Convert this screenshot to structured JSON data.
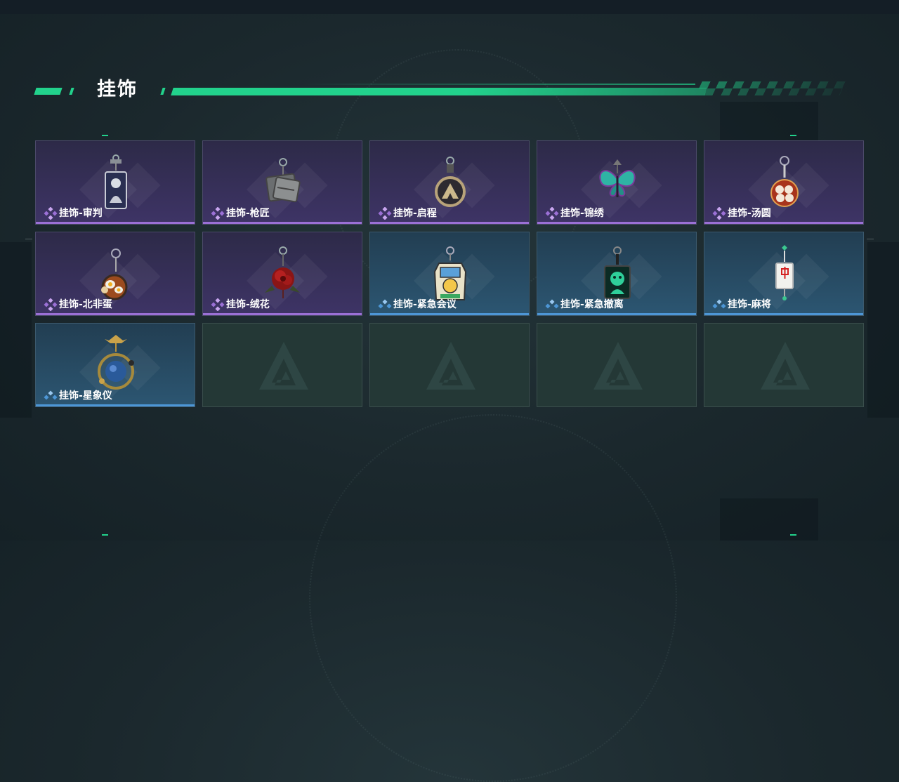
{
  "page": {
    "title": "挂饰"
  },
  "colors": {
    "accent_green": "#22d28c",
    "rarity_purple": "#9b70d6",
    "rarity_blue": "#4d96d6",
    "card_purple": "#3e3466",
    "card_blue": "#2c5672",
    "card_empty": "#243836"
  },
  "items": [
    {
      "label": "挂饰-审判",
      "rarity": "purple",
      "icon": "judgment-card-charm-icon"
    },
    {
      "label": "挂饰-枪匠",
      "rarity": "purple",
      "icon": "gunsmith-tag-charm-icon"
    },
    {
      "label": "挂饰-启程",
      "rarity": "purple",
      "icon": "departure-ring-charm-icon"
    },
    {
      "label": "挂饰-锦绣",
      "rarity": "purple",
      "icon": "butterfly-charm-icon"
    },
    {
      "label": "挂饰-汤圆",
      "rarity": "purple",
      "icon": "tangyuan-bowl-charm-icon"
    },
    {
      "label": "挂饰-北非蛋",
      "rarity": "purple",
      "icon": "shakshuka-charm-icon"
    },
    {
      "label": "挂饰-绒花",
      "rarity": "purple",
      "icon": "red-flower-charm-icon"
    },
    {
      "label": "挂饰-紧急会议",
      "rarity": "blue",
      "icon": "emergency-meeting-charm-icon"
    },
    {
      "label": "挂饰-紧急撤离",
      "rarity": "blue",
      "icon": "emergency-evac-charm-icon"
    },
    {
      "label": "挂饰-麻将",
      "rarity": "blue",
      "icon": "mahjong-tile-charm-icon"
    },
    {
      "label": "挂饰-星象仪",
      "rarity": "blue",
      "icon": "astrolabe-charm-icon"
    }
  ],
  "empty_slots": 4,
  "empty_slot_icon": "game-logo-icon"
}
